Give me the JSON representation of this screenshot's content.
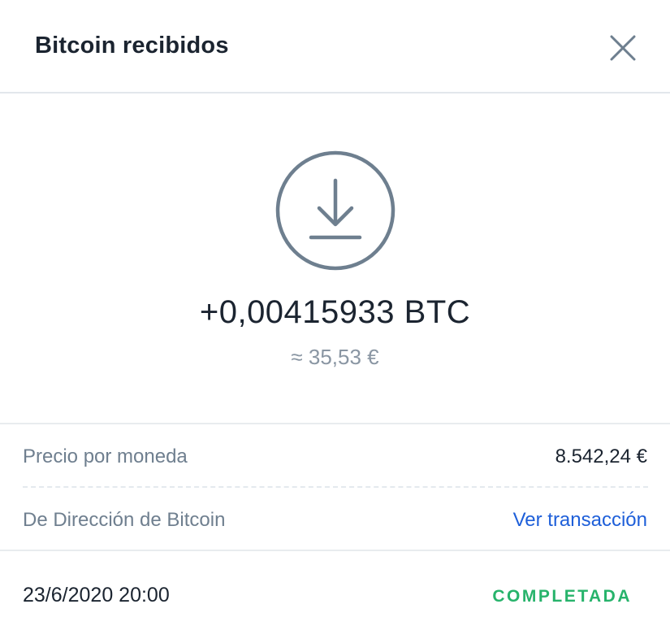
{
  "header": {
    "title": "Bitcoin recibidos",
    "close_icon": "close-icon"
  },
  "transaction": {
    "icon": "download-arrow-icon",
    "amount": "+0,00415933 BTC",
    "fiat_value": "≈ 35,53 €"
  },
  "details": {
    "price_label": "Precio por moneda",
    "price_value": "8.542,24 €",
    "from_label": "De Dirección de Bitcoin",
    "from_link": "Ver transacción"
  },
  "footer": {
    "datetime": "23/6/2020 20:00",
    "status": "COMPLETADA"
  },
  "colors": {
    "icon": "#6e7f8f",
    "link": "#1e5fd9",
    "status": "#27b36b"
  }
}
